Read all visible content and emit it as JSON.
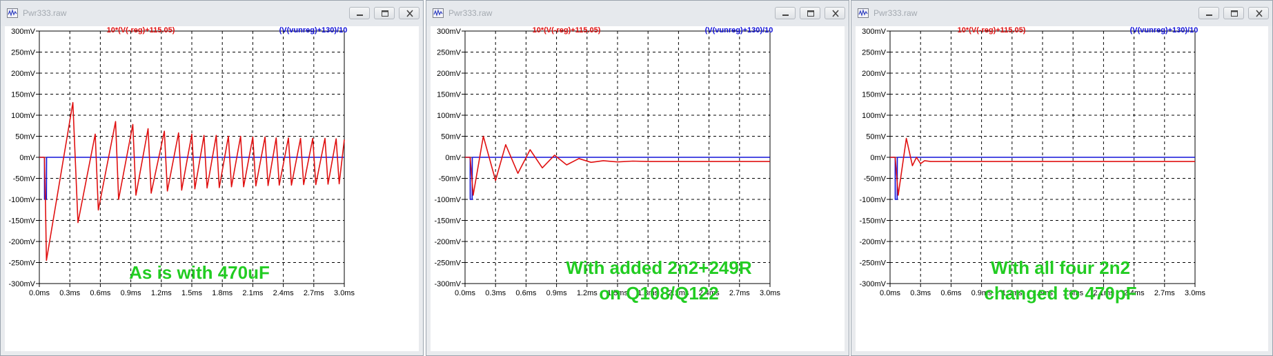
{
  "windows": [
    {
      "title": "Pwr333.raw",
      "trace_labels": {
        "red": "10*(V(-reg)+115.05)",
        "blue": "(V(vunreg)+130)/10"
      },
      "annotation": [
        "As is with 470uF"
      ],
      "buttons": [
        "minimize-icon",
        "maximize-icon",
        "close-icon"
      ]
    },
    {
      "title": "Pwr333.raw",
      "trace_labels": {
        "red": "10*(V(-reg)+115.05)",
        "blue": "(V(vunreg)+130)/10"
      },
      "annotation": [
        "With added 2n2+249R",
        "on Q108/Q122"
      ],
      "buttons": [
        "minimize-icon",
        "maximize-icon",
        "close-icon"
      ]
    },
    {
      "title": "Pwr333.raw",
      "trace_labels": {
        "red": "10*(V(-reg)+115.05)",
        "blue": "(V(vunreg)+130)/10"
      },
      "annotation": [
        "With all four 2n2",
        "changed to 470pF"
      ],
      "buttons": [
        "minimize-icon",
        "maximize-icon",
        "close-icon"
      ]
    }
  ],
  "axes": {
    "y_ticks": [
      "300mV",
      "250mV",
      "200mV",
      "150mV",
      "100mV",
      "50mV",
      "0mV",
      "-50mV",
      "-100mV",
      "-150mV",
      "-200mV",
      "-250mV",
      "-300mV"
    ],
    "x_ticks": [
      "0.0ms",
      "0.3ms",
      "0.6ms",
      "0.9ms",
      "1.2ms",
      "1.5ms",
      "1.8ms",
      "2.1ms",
      "2.4ms",
      "2.7ms",
      "3.0ms"
    ]
  },
  "colors": {
    "red_trace": "#e01010",
    "blue_trace": "#1010d8",
    "annotation": "#22cc22",
    "grid": "#000000"
  },
  "chart_data": [
    {
      "type": "line",
      "x_unit": "ms",
      "y_unit": "mV",
      "xlim": [
        0,
        3.0
      ],
      "ylim": [
        -300,
        300
      ],
      "grid": true,
      "series": [
        {
          "name": "10*(V(-reg)+115.05)",
          "color": "#e01010",
          "x": [
            0.0,
            0.05,
            0.06,
            0.07,
            0.33,
            0.38,
            0.55,
            0.58,
            0.75,
            0.78,
            0.92,
            0.95,
            1.07,
            1.1,
            1.23,
            1.26,
            1.37,
            1.4,
            1.5,
            1.53,
            1.62,
            1.65,
            1.74,
            1.77,
            1.86,
            1.89,
            1.98,
            2.01,
            2.1,
            2.13,
            2.22,
            2.25,
            2.33,
            2.36,
            2.45,
            2.48,
            2.57,
            2.6,
            2.69,
            2.72,
            2.81,
            2.84,
            2.92,
            2.95,
            3.0
          ],
          "y": [
            0,
            0,
            -100,
            -245,
            130,
            -155,
            55,
            -125,
            85,
            -100,
            78,
            -90,
            68,
            -85,
            62,
            -80,
            58,
            -78,
            55,
            -75,
            52,
            -73,
            52,
            -72,
            50,
            -70,
            50,
            -70,
            48,
            -68,
            48,
            -67,
            46,
            -66,
            46,
            -66,
            45,
            -65,
            45,
            -65,
            45,
            -64,
            44,
            -63,
            42
          ]
        },
        {
          "name": "(V(vunreg)+130)/10",
          "color": "#1010d8",
          "x": [
            0.0,
            0.05,
            0.051,
            0.07,
            0.071,
            0.1,
            0.101,
            3.0
          ],
          "y": [
            0,
            0,
            -100,
            -100,
            0,
            0,
            0,
            0
          ]
        }
      ]
    },
    {
      "type": "line",
      "x_unit": "ms",
      "y_unit": "mV",
      "xlim": [
        0,
        3.0
      ],
      "ylim": [
        -300,
        300
      ],
      "grid": true,
      "series": [
        {
          "name": "10*(V(-reg)+115.05)",
          "color": "#e01010",
          "x": [
            0.0,
            0.05,
            0.08,
            0.18,
            0.3,
            0.4,
            0.52,
            0.64,
            0.76,
            0.88,
            1.0,
            1.12,
            1.24,
            1.36,
            1.5,
            1.65,
            1.8,
            2.0,
            2.5,
            3.0
          ],
          "y": [
            0,
            0,
            -90,
            50,
            -55,
            30,
            -38,
            18,
            -25,
            5,
            -18,
            -3,
            -12,
            -8,
            -11,
            -9,
            -10,
            -10,
            -10,
            -10
          ]
        },
        {
          "name": "(V(vunreg)+130)/10",
          "color": "#1010d8",
          "x": [
            0.0,
            0.05,
            0.051,
            0.07,
            0.071,
            3.0
          ],
          "y": [
            0,
            0,
            -100,
            -100,
            0,
            0
          ]
        }
      ]
    },
    {
      "type": "line",
      "x_unit": "ms",
      "y_unit": "mV",
      "xlim": [
        0,
        3.0
      ],
      "ylim": [
        -300,
        300
      ],
      "grid": true,
      "series": [
        {
          "name": "10*(V(-reg)+115.05)",
          "color": "#e01010",
          "x": [
            0.0,
            0.05,
            0.08,
            0.16,
            0.22,
            0.26,
            0.3,
            0.34,
            0.4,
            1.0,
            2.0,
            3.0
          ],
          "y": [
            0,
            0,
            -90,
            45,
            -20,
            0,
            -15,
            -8,
            -10,
            -10,
            -10,
            -10
          ]
        },
        {
          "name": "(V(vunreg)+130)/10",
          "color": "#1010d8",
          "x": [
            0.0,
            0.05,
            0.051,
            0.07,
            0.071,
            3.0
          ],
          "y": [
            0,
            0,
            -100,
            -100,
            0,
            0
          ]
        }
      ]
    }
  ]
}
